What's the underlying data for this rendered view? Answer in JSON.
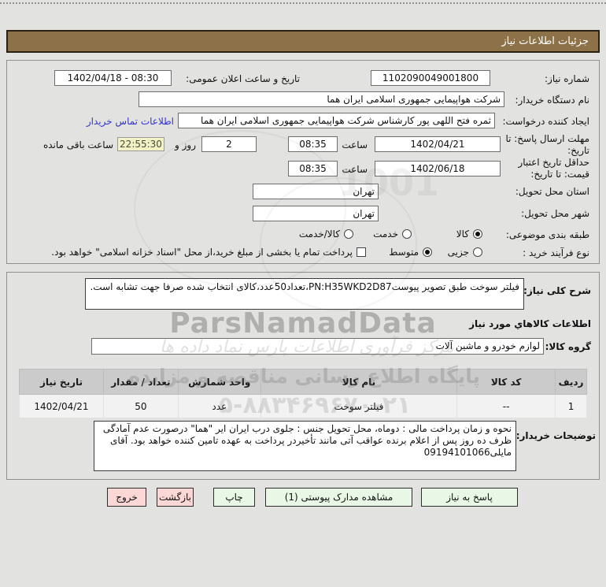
{
  "title_bar": "جزئیات اطلاعات نیاز",
  "fields": {
    "need_number": {
      "label": "شماره نیاز:",
      "value": "1102090049001800"
    },
    "announce": {
      "label": "تاریخ و ساعت اعلان عمومی:",
      "value": "1402/04/18 - 08:30"
    },
    "buyer_org": {
      "label": "نام دستگاه خریدار:",
      "value": "شرکت هواپیمایی جمهوری اسلامی ایران هما"
    },
    "request_creator": {
      "label": "ایجاد کننده درخواست:",
      "value": "ثمره فتح اللهی پور کارشناس شرکت هواپیمایی جمهوری اسلامی ایران هما",
      "contact_link": "اطلاعات تماس خریدار"
    },
    "reply_deadline": {
      "label_line1": "مهلت ارسال پاسخ: تا",
      "label_line2": "تاریخ:",
      "date": "1402/04/21",
      "hour_label": "ساعت",
      "time": "08:35",
      "days": "2",
      "days_label": "روز و",
      "remaining": "22:55:30",
      "remaining_label": "ساعت باقی مانده"
    },
    "price_validity": {
      "label_line1": "حداقل تاریخ اعتبار",
      "label_line2": "قیمت: تا تاریخ:",
      "date": "1402/06/18",
      "hour_label": "ساعت",
      "time": "08:35"
    },
    "province": {
      "label": "استان محل تحویل:",
      "value": "تهران"
    },
    "city": {
      "label": "شهر محل تحویل:",
      "value": "تهران"
    },
    "classification": {
      "label": "طبقه بندی موضوعی:",
      "options": [
        {
          "label": "کالا",
          "selected": true
        },
        {
          "label": "خدمت",
          "selected": false
        },
        {
          "label": "کالا/خدمت",
          "selected": false
        }
      ]
    },
    "process_type": {
      "label": "نوع فرآیند خرید :",
      "options": [
        {
          "label": "جزیی",
          "selected": false
        },
        {
          "label": "متوسط",
          "selected": true
        }
      ],
      "checkbox_label": "پرداخت تمام یا بخشی از مبلغ خرید،از محل \"اسناد خزانه اسلامی\" خواهد بود.",
      "checkbox_checked": false
    }
  },
  "need_section": {
    "desc_label": "شرح کلی نیاز:",
    "desc_value": "فیلتر سوخت طبق تصویر پیوستPN:H35WKD2D87،تعداد50عدد،کالای انتخاب شده صرفا جهت تشابه است.",
    "goods_heading": "اطلاعات کالاهاي مورد نیاز",
    "group_label": "گروه کالا:",
    "group_value": "لوازم خودرو و ماشین آلات"
  },
  "table": {
    "headers": [
      "ردیف",
      "کد کالا",
      "نام کالا",
      "واحد شمارش",
      "تعداد / مقدار",
      "تاریخ نیاز"
    ],
    "rows": [
      [
        "1",
        "--",
        "فیلتر سوخت",
        "عدد",
        "50",
        "1402/04/21"
      ]
    ]
  },
  "buyer_notes": {
    "label": "توضیحات خریدار:",
    "value": "نحوه و زمان پرداخت مالی  : دوماه، محل تحویل جنس : جلوی درب ایران ایر \"هما\"  درصورت عدم آمادگی ظرف ده روز پس از اعلام برنده عواقب آتی مانند تأخیردر پرداخت به عهده تامین کننده خواهد بود. آقای مایلی09194101066"
  },
  "buttons": [
    {
      "label": "پاسخ به نیاز",
      "style": "green"
    },
    {
      "label": "مشاهده مدارک پیوستی (1)",
      "style": "green"
    },
    {
      "label": "چاپ",
      "style": "green"
    },
    {
      "label": "بازگشت",
      "style": "pink"
    },
    {
      "label": "خروج",
      "style": "pink"
    }
  ],
  "watermark": {
    "brand": "ParsNamadData",
    "script_line": "مرکز فرآوری اطلاعات پارس نماد داده ها",
    "info_line": "پایگاه اطلاع رسانی مناقصه و مزایده",
    "phone": "۵-۸۸۳۴۶۹۶۷۰-۲۱",
    "digits": "1001"
  },
  "colors": {
    "title_bar_brown": "#8d7148",
    "link_blue": "#3333cc",
    "button_green": "#e9f7e6",
    "button_pink": "#fbd8d6",
    "remaining_yellow": "#f2f2c6",
    "table_header_gray": "#cbcbcb"
  }
}
